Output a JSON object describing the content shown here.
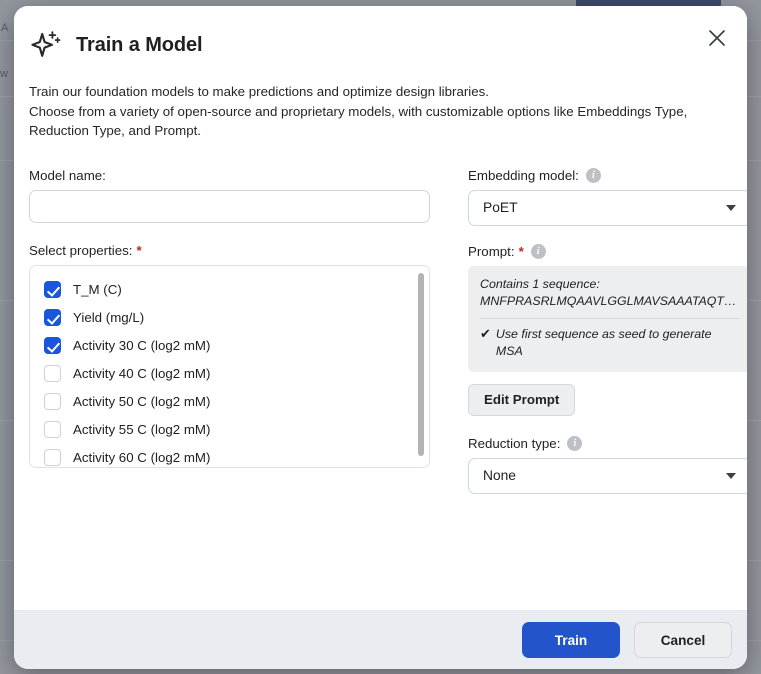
{
  "background": {
    "glyph_a": "A",
    "glyph_w": "w"
  },
  "dialog": {
    "title": "Train a Model",
    "icon": "sparkle-icon",
    "close_icon": "close-icon",
    "description_line1": "Train our foundation models to make predictions and optimize design libraries.",
    "description_line2": "Choose from a variety of open-source and proprietary models, with customizable options like Embeddings Type,",
    "description_line3": "Reduction Type, and Prompt."
  },
  "model_name": {
    "label": "Model name:",
    "value": "",
    "placeholder": ""
  },
  "properties": {
    "label": "Select properties:",
    "required_mark": "*",
    "items": [
      {
        "label": "T_M (C)",
        "checked": true
      },
      {
        "label": "Yield (mg/L)",
        "checked": true
      },
      {
        "label": "Activity 30 C (log2 mM)",
        "checked": true
      },
      {
        "label": "Activity 40 C (log2 mM)",
        "checked": false
      },
      {
        "label": "Activity 50 C (log2 mM)",
        "checked": false
      },
      {
        "label": "Activity 55 C (log2 mM)",
        "checked": false
      },
      {
        "label": "Activity 60 C (log2 mM)",
        "checked": false
      }
    ]
  },
  "embedding_model": {
    "label": "Embedding model:",
    "info_icon": "info-icon",
    "selected": "PoET"
  },
  "prompt": {
    "label": "Prompt:",
    "required_mark": "*",
    "info_icon": "info-icon",
    "contains_line": "Contains 1 sequence:",
    "sequence": "MNFPRASRLMQAAVLGGLMAVSAAATAQTNP…",
    "msa_check": "✔",
    "msa_text": "Use first sequence as seed to generate MSA",
    "edit_button": "Edit Prompt"
  },
  "reduction_type": {
    "label": "Reduction type:",
    "info_icon": "info-icon",
    "selected": "None"
  },
  "footer": {
    "train_label": "Train",
    "cancel_label": "Cancel"
  },
  "colors": {
    "accent": "#2354cc",
    "checkbox": "#1a56db",
    "required": "#c5221f",
    "footer_bg": "#e9edf1",
    "prompt_bg": "#eceef0"
  }
}
